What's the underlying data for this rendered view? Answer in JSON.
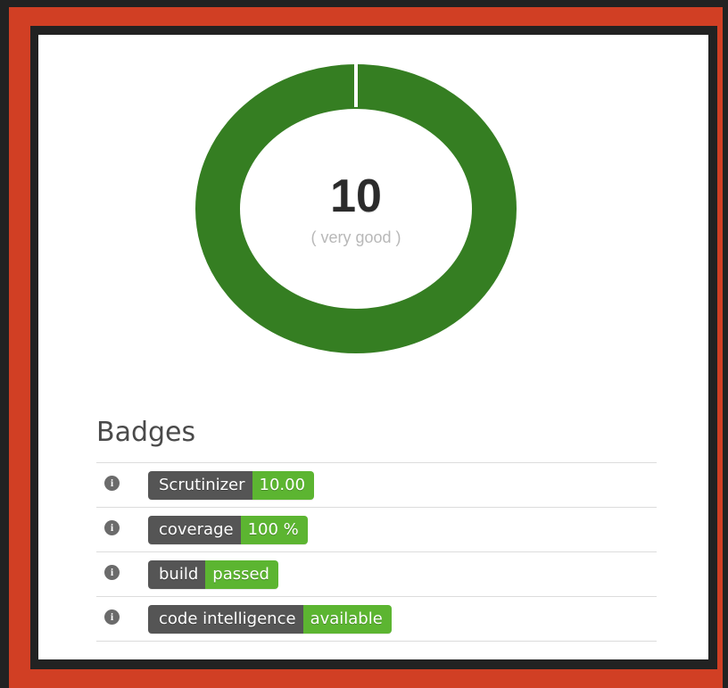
{
  "score": {
    "value": "10",
    "label": "( very good )",
    "fraction": 1.0,
    "ring_color": "#357e22"
  },
  "badges": {
    "title": "Badges",
    "info_icon": "info-icon",
    "items": [
      {
        "subject": "Scrutinizer",
        "status": "10.00"
      },
      {
        "subject": "coverage",
        "status": "100 %"
      },
      {
        "subject": "build",
        "status": "passed"
      },
      {
        "subject": "code intelligence",
        "status": "available"
      }
    ]
  },
  "colors": {
    "frame": "#d13f24",
    "badge_subject": "#555555",
    "badge_status": "#5cb531"
  }
}
